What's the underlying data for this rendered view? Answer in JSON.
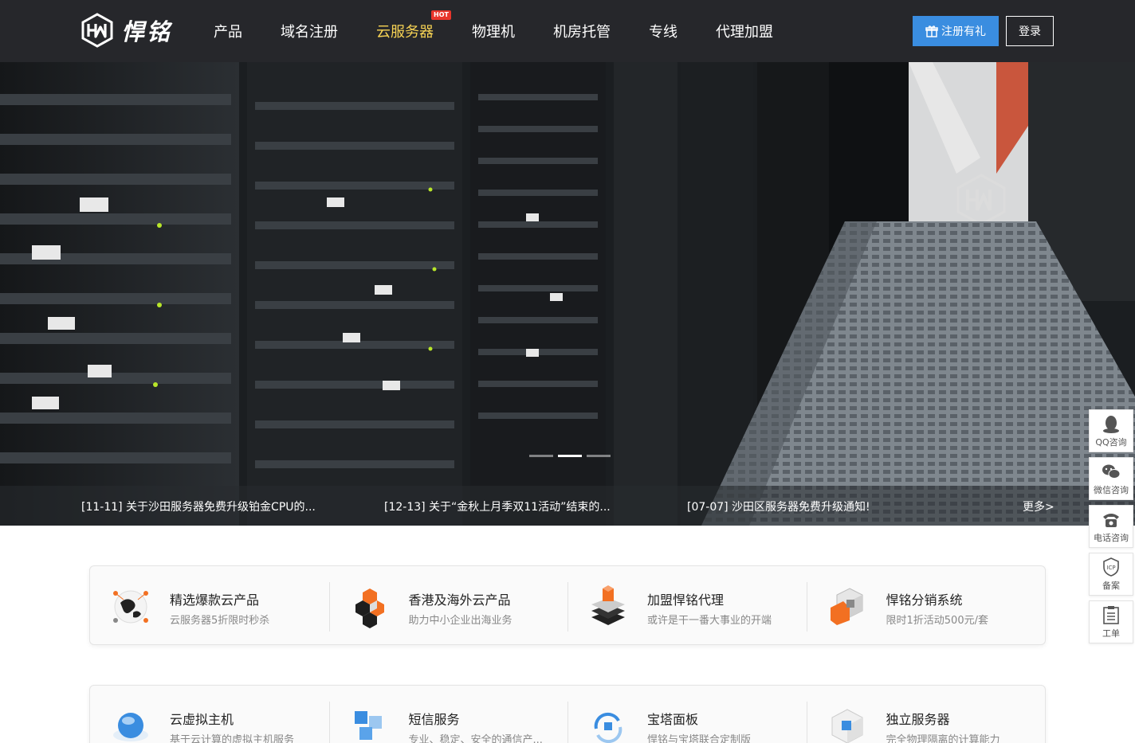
{
  "header": {
    "logo_text": "悍铭",
    "nav": [
      {
        "label": "产品"
      },
      {
        "label": "域名注册"
      },
      {
        "label": "云服务器",
        "badge": "HOT",
        "active": true
      },
      {
        "label": "物理机"
      },
      {
        "label": "机房托管"
      },
      {
        "label": "专线"
      },
      {
        "label": "代理加盟"
      }
    ],
    "register_label": "注册有礼",
    "login_label": "登录"
  },
  "banner": {
    "news": [
      "[11-11] 关于沙田服务器免费升级铂金CPU的...",
      "[12-13] 关于“金秋上月季双11活动”结束的...",
      "[07-07] 沙田区服务器免费升级通知!"
    ],
    "more_label": "更多>",
    "slides": 3,
    "active_slide": 2
  },
  "features_row1": [
    {
      "title": "精选爆款云产品",
      "desc": "云服务器5折限时秒杀",
      "icon": "globe-network-icon"
    },
    {
      "title": "香港及海外云产品",
      "desc": "助力中小企业出海业务",
      "icon": "hex-cubes-icon"
    },
    {
      "title": "加盟悍铭代理",
      "desc": "或许是干一番大事业的开端",
      "icon": "layers-icon"
    },
    {
      "title": "悍铭分销系统",
      "desc": "限时1折活动500元/套",
      "icon": "cube-box-icon"
    }
  ],
  "features_row2": [
    {
      "title": "云虚拟主机",
      "desc": "基于云计算的虚拟主机服务",
      "icon": "cloud-sphere-icon"
    },
    {
      "title": "短信服务",
      "desc": "专业、稳定、安全的通信产...",
      "icon": "sms-blocks-icon"
    },
    {
      "title": "宝塔面板",
      "desc": "悍铭与宝塔联合定制版",
      "icon": "panel-cycle-icon"
    },
    {
      "title": "独立服务器",
      "desc": "完全物理隔离的计算能力",
      "icon": "server-cube-icon"
    }
  ],
  "side_bar": [
    {
      "label": "QQ咨询",
      "icon": "qq-icon"
    },
    {
      "label": "微信咨询",
      "icon": "wechat-icon"
    },
    {
      "label": "电话咨询",
      "icon": "phone-icon"
    },
    {
      "label": "备案",
      "icon": "icp-shield-icon"
    },
    {
      "label": "工单",
      "icon": "ticket-icon"
    }
  ],
  "colors": {
    "header_bg": "#26272b",
    "nav_active": "#f7d354",
    "hot_badge": "#e8352b",
    "register_btn": "#3a8de0",
    "accent_orange": "#f27022"
  }
}
